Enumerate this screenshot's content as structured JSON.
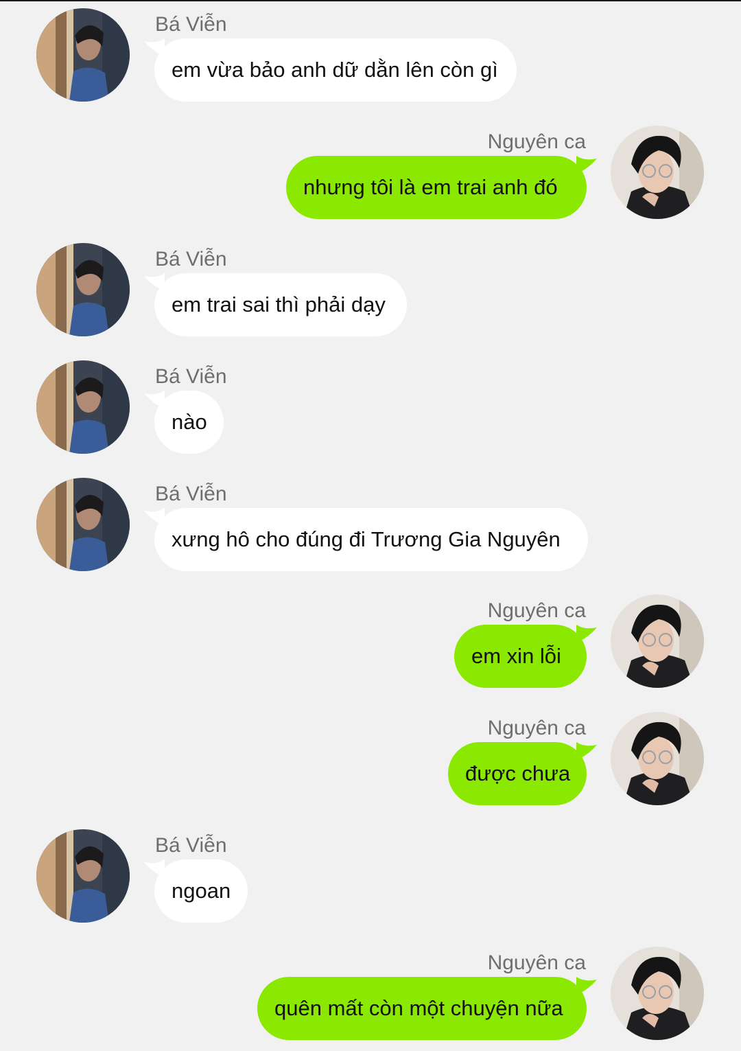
{
  "colors": {
    "background": "#f1f1f1",
    "incoming_bubble": "#ffffff",
    "outgoing_bubble": "#8be800",
    "sender_name": "#6e6e6e",
    "message_text": "#111111"
  },
  "messages": [
    {
      "side": "left",
      "sender": "Bá Viễn",
      "text": "em vừa bảo anh dữ dằn lên còn gì"
    },
    {
      "side": "right",
      "sender": "Nguyên ca",
      "text": "nhưng tôi là em trai anh đó"
    },
    {
      "side": "left",
      "sender": "Bá Viễn",
      "text": "em trai sai thì phải dạy"
    },
    {
      "side": "left",
      "sender": "Bá Viễn",
      "text": "nào"
    },
    {
      "side": "left",
      "sender": "Bá Viễn",
      "text": "xưng hô cho đúng đi Trương Gia Nguyên"
    },
    {
      "side": "right",
      "sender": "Nguyên ca",
      "text": "em xin lỗi"
    },
    {
      "side": "right",
      "sender": "Nguyên ca",
      "text": "được chưa"
    },
    {
      "side": "left",
      "sender": "Bá Viễn",
      "text": "ngoan"
    },
    {
      "side": "right",
      "sender": "Nguyên ca",
      "text": "quên mất còn một chuyện nữa"
    }
  ]
}
